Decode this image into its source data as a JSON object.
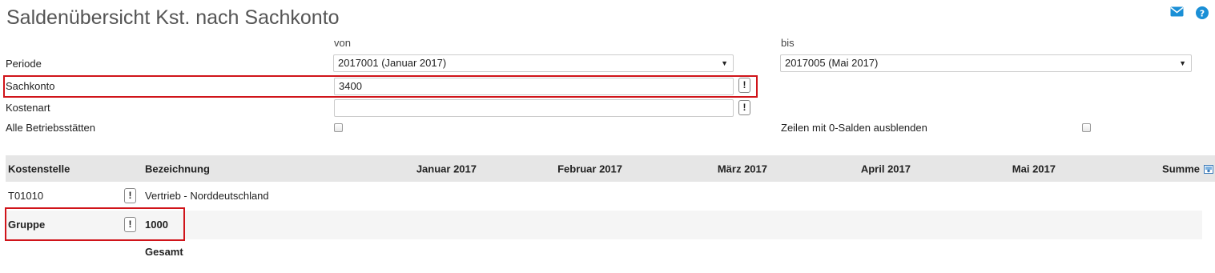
{
  "page": {
    "title": "Saldenübersicht Kst. nach Sachkonto"
  },
  "header_icons": {
    "mail": "mail-icon",
    "help": "help-icon"
  },
  "form": {
    "von_label": "von",
    "bis_label": "bis",
    "periode_label": "Periode",
    "periode_von": "2017001 (Januar 2017)",
    "periode_bis": "2017005 (Mai 2017)",
    "sachkonto_label": "Sachkonto",
    "sachkonto_value": "3400",
    "kostenart_label": "Kostenart",
    "kostenart_value": "",
    "alle_label": "Alle Betriebsstätten",
    "zeilen_label": "Zeilen mit 0-Salden ausblenden",
    "info_symbol": "!"
  },
  "table": {
    "headers": [
      "Kostenstelle",
      "Bezeichnung",
      "Januar 2017",
      "Februar 2017",
      "März 2017",
      "April 2017",
      "Mai 2017",
      "Summe"
    ],
    "rows": [
      {
        "kostenstelle": "T01010",
        "bezeichnung": "Vertrieb - Norddeutschland"
      },
      {
        "kostenstelle": "Gruppe",
        "bezeichnung": "1000"
      },
      {
        "kostenstelle": "",
        "bezeichnung": "Gesamt"
      }
    ]
  },
  "colors": {
    "accent": "#1a8fd6",
    "highlight": "#d0141a",
    "header_bg": "#e6e6e6"
  }
}
